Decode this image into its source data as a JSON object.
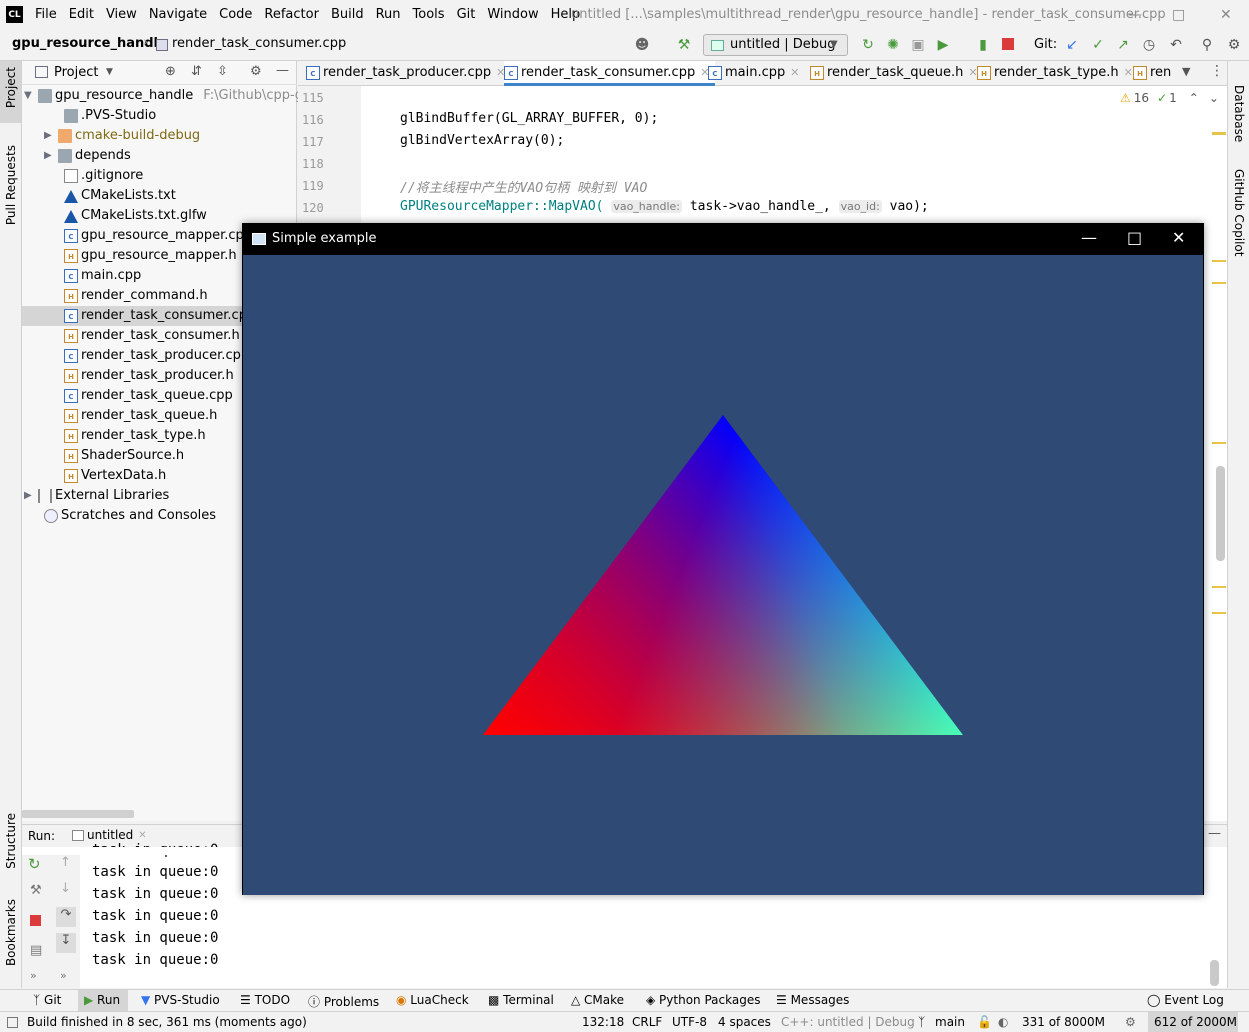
{
  "app": {
    "logo": "CL",
    "menus": [
      "File",
      "Edit",
      "View",
      "Navigate",
      "Code",
      "Refactor",
      "Build",
      "Run",
      "Tools",
      "Git",
      "Window",
      "Help"
    ],
    "window_title": "untitled [...\\samples\\multithread_render\\gpu_resource_handle] - render_task_consumer.cpp"
  },
  "navbar": {
    "crumb_project": "gpu_resource_handle",
    "crumb_file": "render_task_consumer.cpp",
    "run_config": "untitled | Debug",
    "git_label": "Git:"
  },
  "left_strip": [
    "Project",
    "Pull Requests",
    "Structure",
    "Bookmarks"
  ],
  "right_strip": [
    "Database",
    "GitHub Copilot"
  ],
  "project": {
    "title": "Project",
    "root": "gpu_resource_handle",
    "root_path": "F:\\Github\\cpp-ga",
    "items": [
      {
        "label": ".PVS-Studio",
        "type": "folder"
      },
      {
        "label": "cmake-build-debug",
        "type": "folder-o"
      },
      {
        "label": "depends",
        "type": "folder"
      },
      {
        "label": ".gitignore",
        "type": "txt"
      },
      {
        "label": "CMakeLists.txt",
        "type": "cmake"
      },
      {
        "label": "CMakeLists.txt.glfw",
        "type": "cmake"
      },
      {
        "label": "gpu_resource_mapper.cpp",
        "type": "cpp"
      },
      {
        "label": "gpu_resource_mapper.h",
        "type": "h"
      },
      {
        "label": "main.cpp",
        "type": "cpp"
      },
      {
        "label": "render_command.h",
        "type": "h"
      },
      {
        "label": "render_task_consumer.cpp",
        "type": "cpp"
      },
      {
        "label": "render_task_consumer.h",
        "type": "h"
      },
      {
        "label": "render_task_producer.cpp",
        "type": "cpp"
      },
      {
        "label": "render_task_producer.h",
        "type": "h"
      },
      {
        "label": "render_task_queue.cpp",
        "type": "cpp"
      },
      {
        "label": "render_task_queue.h",
        "type": "h"
      },
      {
        "label": "render_task_type.h",
        "type": "h"
      },
      {
        "label": "ShaderSource.h",
        "type": "h"
      },
      {
        "label": "VertexData.h",
        "type": "h"
      }
    ],
    "external": "External Libraries",
    "scratches": "Scratches and Consoles"
  },
  "tabs": [
    {
      "label": "render_task_producer.cpp",
      "active": false
    },
    {
      "label": "render_task_consumer.cpp",
      "active": true
    },
    {
      "label": "main.cpp",
      "active": false
    },
    {
      "label": "render_task_queue.h",
      "active": false
    },
    {
      "label": "render_task_type.h",
      "active": false
    },
    {
      "label": "ren",
      "active": false
    }
  ],
  "editor": {
    "warnings": "16",
    "checks": "1",
    "lines": [
      "115",
      "116",
      "117",
      "118",
      "119",
      "120"
    ],
    "code_116": "glBindBuffer(GL_ARRAY_BUFFER, 0);",
    "code_117": "glBindVertexArray(0);",
    "code_119": "//将主线程中产生的VAO句柄 映射到 VAO",
    "code_120_a": "GPUResourceMapper::MapVAO(",
    "hint_1": "vao_handle:",
    "code_120_b": "task->vao_handle_,",
    "hint_2": "vao_id:",
    "code_120_c": "vao);"
  },
  "run": {
    "label": "Run:",
    "tab": "untitled",
    "output": [
      "task in queue:0",
      "task in queue:0",
      "task in queue:0",
      "task in queue:0",
      "task in queue:0",
      "task in queue:0",
      "task in queue:0"
    ]
  },
  "bottom_tabs": [
    "Git",
    "Run",
    "PVS-Studio",
    "TODO",
    "Problems",
    "LuaCheck",
    "Terminal",
    "CMake",
    "Python Packages",
    "Messages",
    "Event Log"
  ],
  "status": {
    "message": "Build finished in 8 sec, 361 ms (moments ago)",
    "position": "132:18",
    "line_ending": "CRLF",
    "encoding": "UTF-8",
    "indent": "4 spaces",
    "context": "C++: untitled | Debug",
    "branch": "main",
    "memory_a": "331 of 8000M",
    "memory_b": "612 of 2000M"
  },
  "gl_window": {
    "title": "Simple example",
    "background": "#2f4a74",
    "vertex_colors": {
      "top": "#0000ff",
      "left": "#ff0000",
      "right": "#00ff00"
    }
  }
}
